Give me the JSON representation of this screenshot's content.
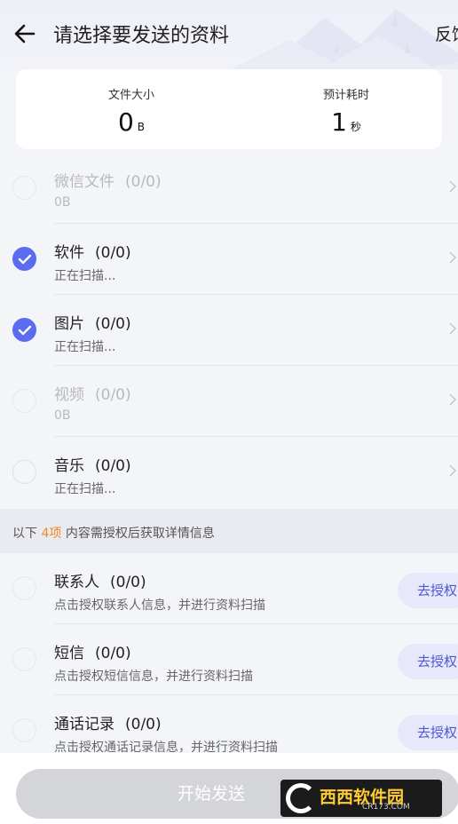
{
  "header": {
    "title": "请选择要发送的资料",
    "feedback": "反馈"
  },
  "summary": {
    "size_label": "文件大小",
    "size_value": "0",
    "size_unit": "B",
    "time_label": "预计耗时",
    "time_value": "1",
    "time_unit": "秒"
  },
  "items": [
    {
      "name": "微信文件",
      "count": "(0/0)",
      "sub": "0B",
      "state": "disabled"
    },
    {
      "name": "软件",
      "count": "(0/0)",
      "sub": "正在扫描...",
      "state": "checked"
    },
    {
      "name": "图片",
      "count": "(0/0)",
      "sub": "正在扫描...",
      "state": "checked"
    },
    {
      "name": "视频",
      "count": "(0/0)",
      "sub": "0B",
      "state": "disabled"
    },
    {
      "name": "音乐",
      "count": "(0/0)",
      "sub": "正在扫描...",
      "state": "unchecked"
    }
  ],
  "notice": {
    "prefix": "以下",
    "highlight": "4项",
    "suffix": "内容需授权后获取详情信息"
  },
  "auth_items": [
    {
      "name": "联系人",
      "count": "(0/0)",
      "sub": "点击授权联系人信息，并进行资料扫描",
      "button": "去授权"
    },
    {
      "name": "短信",
      "count": "(0/0)",
      "sub": "点击授权短信信息，并进行资料扫描",
      "button": "去授权"
    },
    {
      "name": "通话记录",
      "count": "(0/0)",
      "sub": "点击授权通话记录信息，并进行资料扫描",
      "button": "去授权"
    }
  ],
  "bottom": {
    "start_label": "开始发送"
  },
  "watermark": {
    "brand": "西西软件园",
    "url": "CR173.COM"
  },
  "colors": {
    "accent": "#5b6cf0",
    "highlight": "#f08a24",
    "auth_button_bg": "#e7e9fb",
    "disabled_button": "#d4d5d9"
  }
}
